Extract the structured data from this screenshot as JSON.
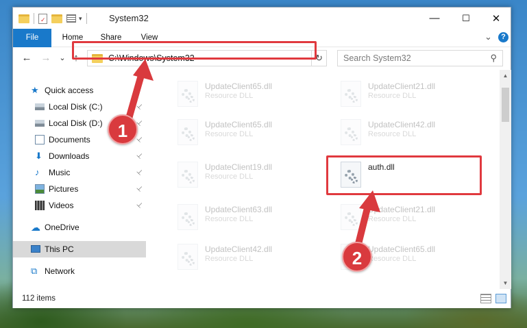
{
  "window": {
    "title": "System32",
    "controls": {
      "minimize": "—",
      "maximize": "☐",
      "close": "✕"
    }
  },
  "ribbon": {
    "tabs": [
      "File",
      "Home",
      "Share",
      "View"
    ],
    "expand_glyph": "⌄",
    "help_glyph": "?"
  },
  "nav": {
    "back": "←",
    "forward": "→",
    "recent": "⌄",
    "up": "↑",
    "address": "C:\\Windows\\System32",
    "address_drop": "⌄",
    "refresh": "↻",
    "search_placeholder": "Search System32",
    "search_glyph": "⚲"
  },
  "sidebar": {
    "items": [
      {
        "label": "Quick access",
        "icon": "star-icon",
        "pinned": false
      },
      {
        "label": "Local Disk (C:)",
        "icon": "drive-icon",
        "pinned": true
      },
      {
        "label": "Local Disk (D:)",
        "icon": "drive-icon",
        "pinned": true
      },
      {
        "label": "Documents",
        "icon": "documents-icon",
        "pinned": true
      },
      {
        "label": "Downloads",
        "icon": "download-icon",
        "pinned": true
      },
      {
        "label": "Music",
        "icon": "music-icon",
        "pinned": true
      },
      {
        "label": "Pictures",
        "icon": "pictures-icon",
        "pinned": true
      },
      {
        "label": "Videos",
        "icon": "videos-icon",
        "pinned": true
      },
      {
        "label": "OneDrive",
        "icon": "cloud-icon",
        "pinned": false
      },
      {
        "label": "This PC",
        "icon": "monitor-icon",
        "pinned": false,
        "selected": true
      },
      {
        "label": "Network",
        "icon": "network-icon",
        "pinned": false
      }
    ],
    "pin_glyph": "📌"
  },
  "files": [
    {
      "name": "UpdateClient65.dll",
      "type": "Resource DLL",
      "faded": true
    },
    {
      "name": "UpdateClient21.dll",
      "type": "Resource DLL",
      "faded": true
    },
    {
      "name": "UpdateClient65.dll",
      "type": "Resource DLL",
      "faded": true
    },
    {
      "name": "UpdateClient42.dll",
      "type": "Resource DLL",
      "faded": true
    },
    {
      "name": "UpdateClient19.dll",
      "type": "Resource DLL",
      "faded": true
    },
    {
      "name": "auth.dll",
      "type": "",
      "faded": false
    },
    {
      "name": "UpdateClient63.dll",
      "type": "Resource DLL",
      "faded": true
    },
    {
      "name": "UpdateClient21.dll",
      "type": "Resource DLL",
      "faded": true
    },
    {
      "name": "UpdateClient42.dll",
      "type": "Resource DLL",
      "faded": true
    },
    {
      "name": "UpdateClient65.dll",
      "type": "Resource DLL",
      "faded": true
    }
  ],
  "status": {
    "item_count": "112 items"
  },
  "callouts": {
    "step1": "1",
    "step2": "2"
  },
  "colors": {
    "accent": "#1979ca",
    "highlight_red": "#e0393e",
    "selected_bg": "#d9d9d9"
  }
}
